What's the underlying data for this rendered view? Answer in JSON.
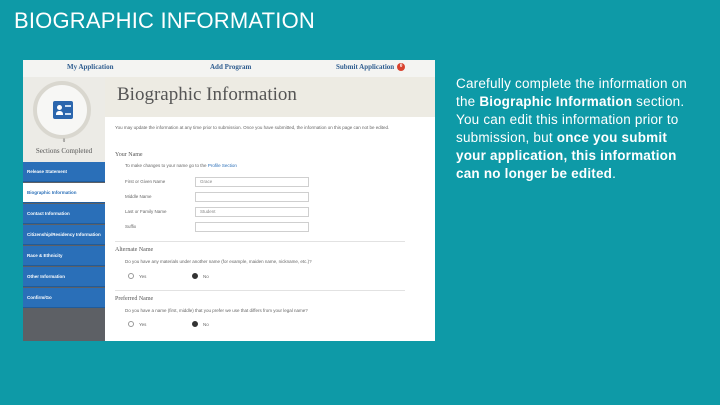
{
  "slide": {
    "title": "BIOGRAPHIC INFORMATION",
    "description": {
      "p1": "Carefully complete the information on the ",
      "b1": "Biographic Information",
      "p2": " section. You can edit this information prior to submission, but ",
      "b2": "once you submit your application, this information can no longer be edited",
      "p3": "."
    }
  },
  "app": {
    "nav": {
      "my_application": "My Application",
      "add_program": "Add Program",
      "submit_application": "Submit Application",
      "submit_badge": "0"
    },
    "sidebar": {
      "sections_completed_number": "0",
      "sections_completed_label": "Sections Completed",
      "items": [
        {
          "label": "Release Statement"
        },
        {
          "label": "Biographic Information"
        },
        {
          "label": "Contact Information"
        },
        {
          "label": "Citizenship/Residency Information"
        },
        {
          "label": "Race & Ethnicity"
        },
        {
          "label": "Other Information"
        },
        {
          "label": "Confirm/Go"
        }
      ]
    },
    "page_title": "Biographic Information",
    "note": "You may update the information at any time prior to submission. Once you have submitted, the information on this page can not be edited.",
    "your_name": {
      "heading": "Your Name",
      "hint_pre": "To make changes to your name go to the ",
      "hint_link": "Profile Section",
      "fields": [
        {
          "label": "First or Given Name",
          "value": "Grace"
        },
        {
          "label": "Middle Name",
          "value": ""
        },
        {
          "label": "Last or Family Name",
          "value": "Student"
        },
        {
          "label": "Suffix",
          "value": ""
        }
      ]
    },
    "alternate_name": {
      "heading": "Alternate Name",
      "question": "Do you have any materials under another name (for example, maiden name, nickname, etc.)?",
      "yes": "Yes",
      "no": "No"
    },
    "preferred_name": {
      "heading": "Preferred Name",
      "question": "Do you have a name (first, middle) that you prefer we use that differs from your legal name?",
      "yes": "Yes",
      "no": "No"
    }
  }
}
